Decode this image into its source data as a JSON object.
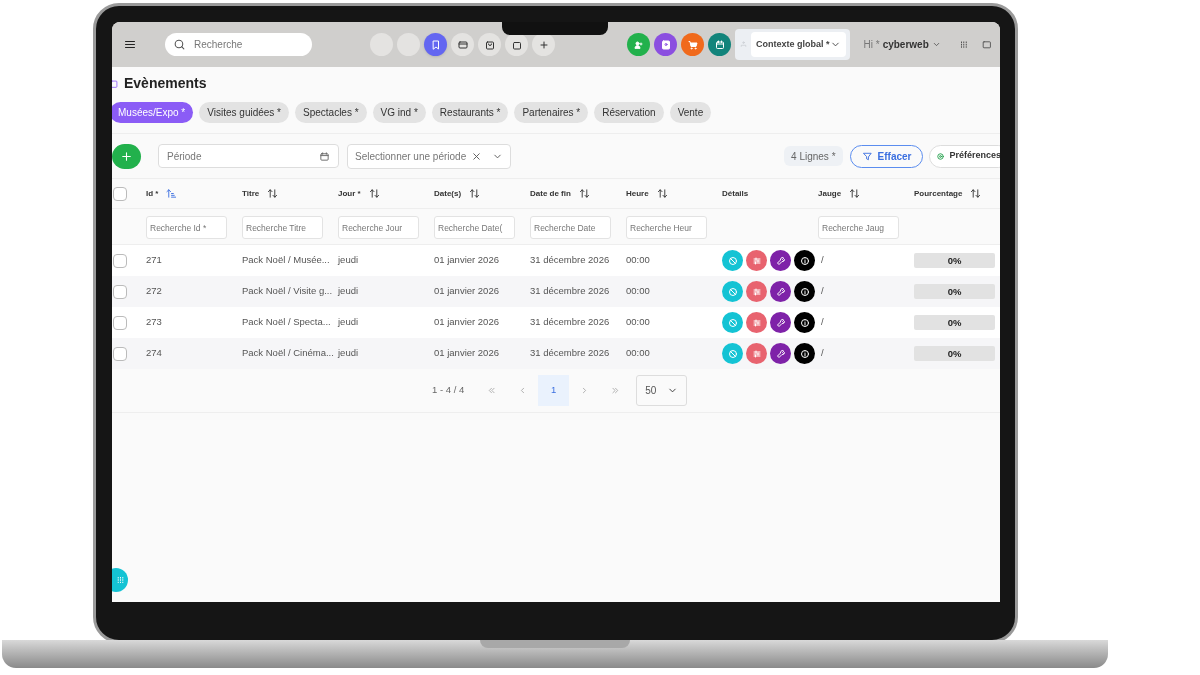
{
  "header": {
    "search": {
      "placeholder": "Recherche"
    },
    "quick_icons": [
      {
        "selected": false
      },
      {
        "selected": false
      },
      {
        "selected": true
      },
      {
        "selected": false
      },
      {
        "selected": false
      },
      {
        "selected": false
      },
      {
        "selected": false
      }
    ],
    "context": {
      "value": "Contexte global *"
    },
    "user": {
      "greeting": "Hi *",
      "name": "cyberweb"
    }
  },
  "page_title": "Evènements",
  "tabs": [
    {
      "label": "Musées/Expo *",
      "selected": true
    },
    {
      "label": "Visites guidées *",
      "selected": false
    },
    {
      "label": "Spectacles *",
      "selected": false
    },
    {
      "label": "VG ind *",
      "selected": false
    },
    {
      "label": "Restaurants *",
      "selected": false
    },
    {
      "label": "Partenaires *",
      "selected": false
    },
    {
      "label": "Réservation",
      "selected": false
    },
    {
      "label": "Vente",
      "selected": false
    }
  ],
  "toolbar": {
    "period": {
      "placeholder": "Période"
    },
    "period_select": {
      "placeholder": "Selectionner une période"
    },
    "row_count": "4 Lignes *",
    "clear_button": "Effacer",
    "preferences_button": "Préférences"
  },
  "table": {
    "all_checked": false,
    "columns": [
      {
        "label": "Id *",
        "sortable": true,
        "sorted": true,
        "placeholder": "Recherche Id *"
      },
      {
        "label": "Titre",
        "sortable": true,
        "sorted": false,
        "placeholder": "Recherche Titre"
      },
      {
        "label": "Jour *",
        "sortable": true,
        "sorted": false,
        "placeholder": "Recherche Jour"
      },
      {
        "label": "Date(s)",
        "sortable": true,
        "sorted": false,
        "placeholder": "Recherche Date("
      },
      {
        "label": "Date de fin",
        "sortable": true,
        "sorted": false,
        "placeholder": "Recherche Date"
      },
      {
        "label": "Heure",
        "sortable": true,
        "sorted": false,
        "placeholder": "Recherche Heur"
      },
      {
        "label": "Détails",
        "sortable": false,
        "sorted": false
      },
      {
        "label": "Jauge",
        "sortable": true,
        "sorted": false,
        "placeholder": "Recherche Jaug"
      },
      {
        "label": "Pourcentage",
        "sortable": true,
        "sorted": false
      }
    ],
    "rows": [
      {
        "checked": false,
        "id": "271",
        "title": "Pack Noël / Musée...",
        "day": "jeudi",
        "start": "01 janvier 2026",
        "end": "31 décembre 2026",
        "time": "00:00",
        "gauge": "/",
        "percent": "0%",
        "level": 0
      },
      {
        "checked": false,
        "id": "272",
        "title": "Pack Noël / Visite g...",
        "day": "jeudi",
        "start": "01 janvier 2026",
        "end": "31 décembre 2026",
        "time": "00:00",
        "gauge": "/",
        "percent": "0%",
        "level": 0
      },
      {
        "checked": false,
        "id": "273",
        "title": "Pack Noël / Specta...",
        "day": "jeudi",
        "start": "01 janvier 2026",
        "end": "31 décembre 2026",
        "time": "00:00",
        "gauge": "/",
        "percent": "0%",
        "level": 0
      },
      {
        "checked": false,
        "id": "274",
        "title": "Pack Noël / Cinéma...",
        "day": "jeudi",
        "start": "01 janvier 2026",
        "end": "31 décembre 2026",
        "time": "00:00",
        "gauge": "/",
        "percent": "0%",
        "level": 0
      }
    ]
  },
  "pagination": {
    "range": "1 - 4 / 4",
    "pages": [
      {
        "label": "1",
        "selected": true
      }
    ],
    "page_size": "50"
  }
}
